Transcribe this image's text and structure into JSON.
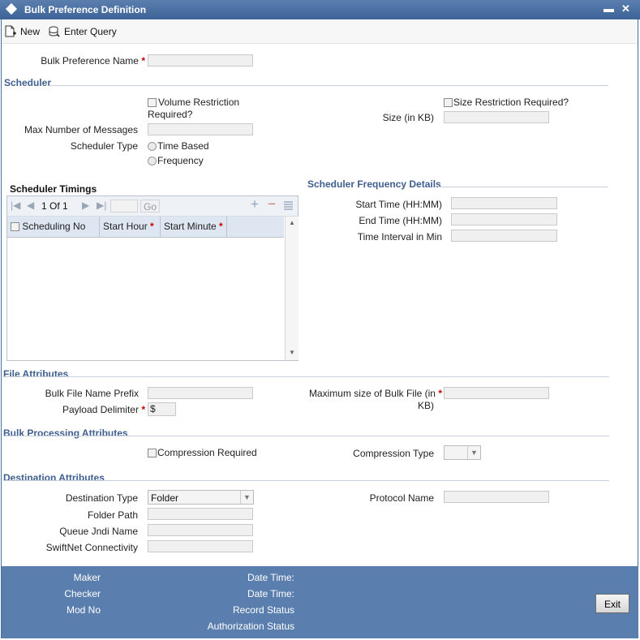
{
  "window": {
    "title": "Bulk Preference Definition",
    "minimize": "▬",
    "close": "✕"
  },
  "toolbar": {
    "new_label": "New",
    "enter_query_label": "Enter Query"
  },
  "bulk_pref": {
    "label": "Bulk Preference Name",
    "req": "*",
    "value": ""
  },
  "scheduler": {
    "section": "Scheduler",
    "volume_restriction_label": "Volume Restriction Required?",
    "size_restriction_label": "Size Restriction Required?",
    "max_messages_label": "Max Number of Messages",
    "size_kb_label": "Size (in KB)",
    "scheduler_type_label": "Scheduler Type",
    "type_options": [
      "Time Based",
      "Frequency"
    ]
  },
  "timings": {
    "section": "Scheduler Timings",
    "page_text": "1 Of 1",
    "go_label": "Go",
    "columns": [
      "Scheduling No",
      "Start Hour",
      "Start Minute"
    ],
    "req": "*"
  },
  "frequency": {
    "section": "Scheduler Frequency Details",
    "start_time_label": "Start Time (HH:MM)",
    "end_time_label": "End Time (HH:MM)",
    "interval_label": "Time Interval in Min"
  },
  "file_attr": {
    "section": "File Attributes",
    "prefix_label": "Bulk File Name Prefix",
    "delimiter_label": "Payload Delimiter",
    "delimiter_value": "$",
    "max_size_label_1": "Maximum size of Bulk File (in",
    "max_size_label_2": "KB)",
    "req": "*"
  },
  "processing": {
    "section": "Bulk Processing Attributes",
    "compression_required_label": "Compression Required",
    "compression_type_label": "Compression Type"
  },
  "destination": {
    "section": "Destination Attributes",
    "type_label": "Destination Type",
    "type_value": "Folder",
    "protocol_label": "Protocol Name",
    "folder_path_label": "Folder Path",
    "queue_label": "Queue Jndi Name",
    "swiftnet_label": "SwiftNet Connectivity"
  },
  "footer": {
    "maker": "Maker",
    "checker": "Checker",
    "mod_no": "Mod No",
    "date_time_1": "Date Time:",
    "date_time_2": "Date Time:",
    "record_status": "Record Status",
    "auth_status": "Authorization Status",
    "exit_label": "Exit"
  },
  "colors": {
    "title_bar": "#3d6397",
    "footer": "#5a7fae",
    "section_text": "#3f5f8f",
    "required": "#cc0000"
  }
}
